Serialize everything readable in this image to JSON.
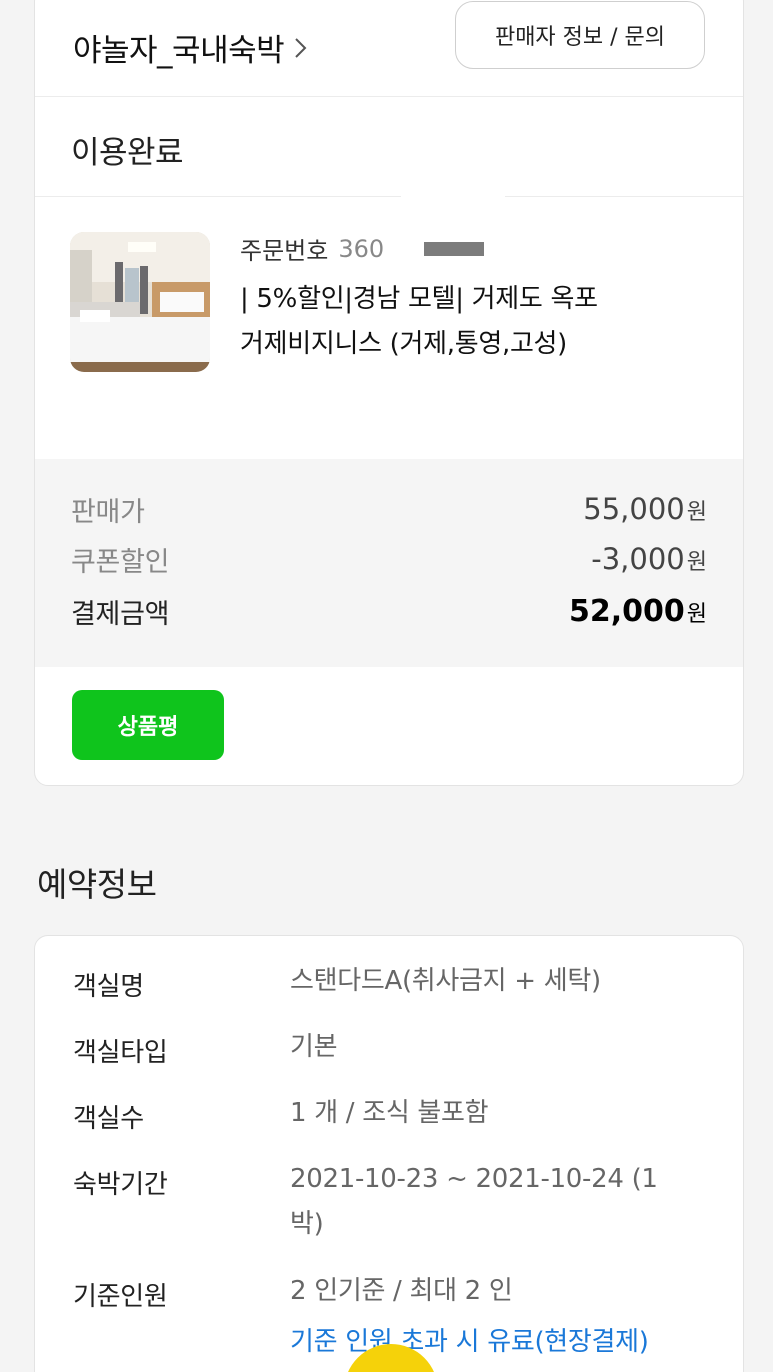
{
  "seller": {
    "name": "야놀자_국내숙박",
    "info_button": "판매자 정보 / 문의"
  },
  "order": {
    "status": "이용완료",
    "order_number_label": "주문번호",
    "order_number": "360",
    "product_title": "| 5%할인|경남 모텔| 거제도 옥포 거제비지니스 (거제,통영,고성)"
  },
  "prices": [
    {
      "label": "판매가",
      "value": "55,000",
      "unit": "원"
    },
    {
      "label": "쿠폰할인",
      "value": "-3,000",
      "unit": "원"
    },
    {
      "label": "결제금액",
      "value": "52,000",
      "unit": "원"
    }
  ],
  "review_button": "상품평",
  "reservation": {
    "title": "예약정보",
    "rows": [
      {
        "key": "객실명",
        "value": "스탠다드A(취사금지 + 세탁)"
      },
      {
        "key": "객실타입",
        "value": "기본"
      },
      {
        "key": "객실수",
        "value": "1 개 / 조식 불포함"
      },
      {
        "key": "숙박기간",
        "value": "2021-10-23 ~ 2021-10-24 (1박)"
      },
      {
        "key": "기준인원",
        "value": "2 인기준 / 최대 2 인"
      }
    ],
    "note": "기준 인원 초과 시 유료(현장결제)"
  },
  "colors": {
    "accent_green": "#0fc41c",
    "link_blue": "#1a78d8"
  }
}
